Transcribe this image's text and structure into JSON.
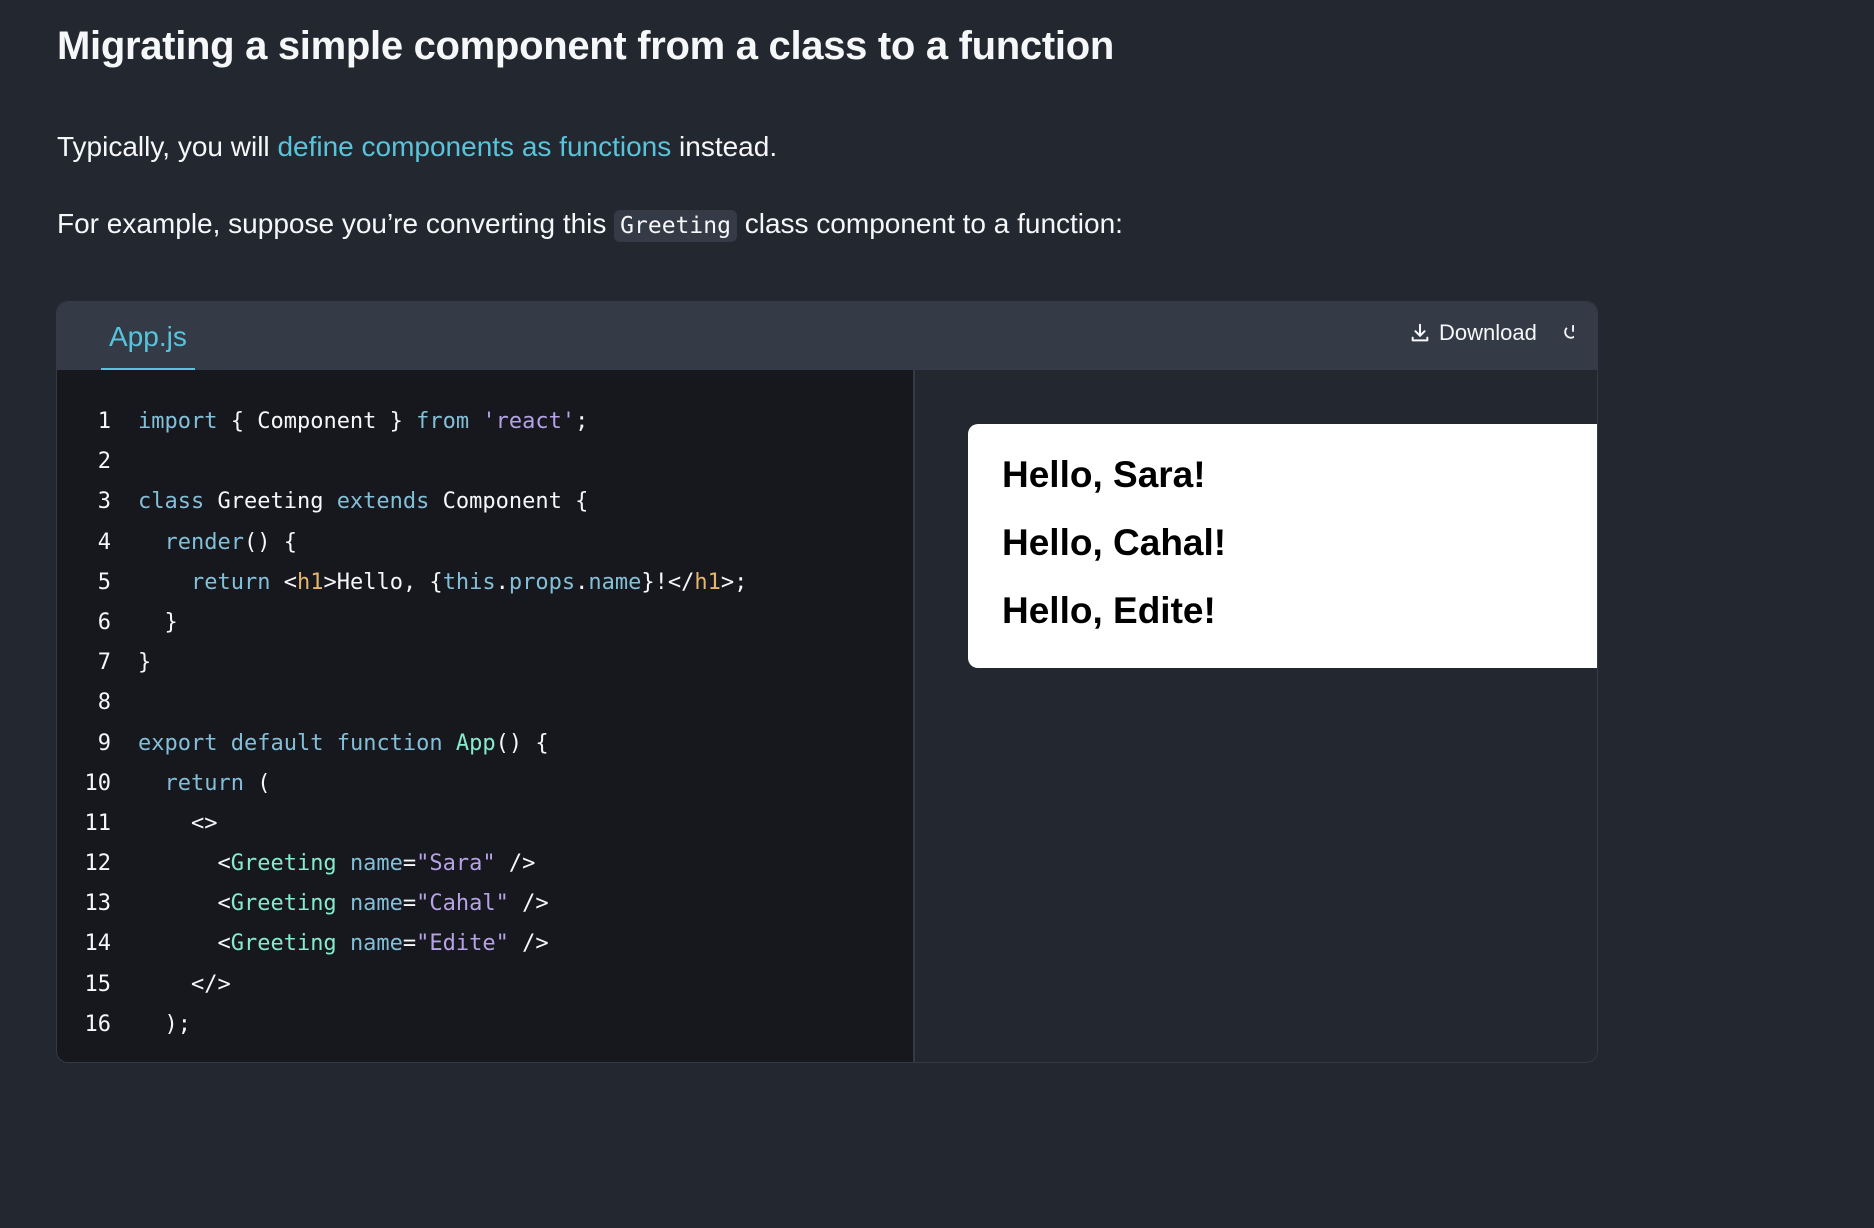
{
  "heading": "Migrating a simple component from a class to a function",
  "para1": {
    "before": "Typically, you will ",
    "link": "define components as functions",
    "after": " instead."
  },
  "para2": {
    "before": "For example, suppose you’re converting this ",
    "code": "Greeting",
    "after": " class component to a function:"
  },
  "sandbox": {
    "tab_label": "App.js",
    "download_label": "Download",
    "code_lines": [
      [
        [
          "kw",
          "import"
        ],
        [
          "pl",
          " { Component } "
        ],
        [
          "kw",
          "from"
        ],
        [
          "pl",
          " "
        ],
        [
          "str",
          "'react'"
        ],
        [
          "pl",
          ";"
        ]
      ],
      [],
      [
        [
          "kw",
          "class"
        ],
        [
          "pl",
          " Greeting "
        ],
        [
          "kw",
          "extends"
        ],
        [
          "pl",
          " Component {"
        ]
      ],
      [
        [
          "pl",
          "  "
        ],
        [
          "kw",
          "render"
        ],
        [
          "pl",
          "() {"
        ]
      ],
      [
        [
          "pl",
          "    "
        ],
        [
          "kw",
          "return"
        ],
        [
          "pl",
          " <"
        ],
        [
          "tag",
          "h1"
        ],
        [
          "pl",
          ">Hello, {"
        ],
        [
          "prop",
          "this"
        ],
        [
          "pl",
          "."
        ],
        [
          "prop",
          "props"
        ],
        [
          "pl",
          "."
        ],
        [
          "prop",
          "name"
        ],
        [
          "pl",
          "}!</"
        ],
        [
          "tag",
          "h1"
        ],
        [
          "pl",
          ">;"
        ]
      ],
      [
        [
          "pl",
          "  }"
        ]
      ],
      [
        [
          "pl",
          "}"
        ]
      ],
      [],
      [
        [
          "kw",
          "export"
        ],
        [
          "pl",
          " "
        ],
        [
          "kw",
          "default"
        ],
        [
          "pl",
          " "
        ],
        [
          "kw",
          "function"
        ],
        [
          "pl",
          " "
        ],
        [
          "fn",
          "App"
        ],
        [
          "pl",
          "() {"
        ]
      ],
      [
        [
          "pl",
          "  "
        ],
        [
          "kw",
          "return"
        ],
        [
          "pl",
          " ("
        ]
      ],
      [
        [
          "pl",
          "    <>"
        ]
      ],
      [
        [
          "pl",
          "      <"
        ],
        [
          "comp",
          "Greeting"
        ],
        [
          "pl",
          " "
        ],
        [
          "attr",
          "name"
        ],
        [
          "pl",
          "="
        ],
        [
          "str",
          "\"Sara\""
        ],
        [
          "pl",
          " />"
        ]
      ],
      [
        [
          "pl",
          "      <"
        ],
        [
          "comp",
          "Greeting"
        ],
        [
          "pl",
          " "
        ],
        [
          "attr",
          "name"
        ],
        [
          "pl",
          "="
        ],
        [
          "str",
          "\"Cahal\""
        ],
        [
          "pl",
          " />"
        ]
      ],
      [
        [
          "pl",
          "      <"
        ],
        [
          "comp",
          "Greeting"
        ],
        [
          "pl",
          " "
        ],
        [
          "attr",
          "name"
        ],
        [
          "pl",
          "="
        ],
        [
          "str",
          "\"Edite\""
        ],
        [
          "pl",
          " />"
        ]
      ],
      [
        [
          "pl",
          "    </>"
        ]
      ],
      [
        [
          "pl",
          "  );"
        ]
      ]
    ],
    "preview_lines": [
      "Hello, Sara!",
      "Hello, Cahal!",
      "Hello, Edite!"
    ]
  }
}
